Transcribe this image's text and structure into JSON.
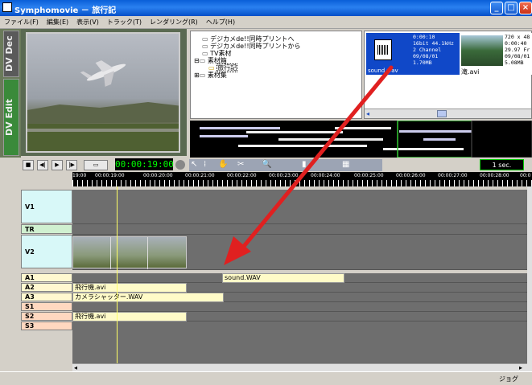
{
  "window": {
    "title": "Symphomovie － 旅行記"
  },
  "menu": [
    "ファイル(F)",
    "編集(E)",
    "表示(V)",
    "トラック(T)",
    "レンダリング(R)",
    "ヘルプ(H)"
  ],
  "side_tabs": [
    "DV Dec",
    "DV Edit"
  ],
  "tree": {
    "items": [
      "デジカメde!!同時プリントへ",
      "デジカメde!!同時プリントから",
      "TV素材",
      "素材箱",
      "旅行記",
      "素材集"
    ]
  },
  "clips": [
    {
      "info": [
        "0:00:10",
        "16bit 44.1kHz",
        "2 Channel",
        "09/08/01",
        "1.70MB"
      ],
      "name": "sound.wav"
    },
    {
      "info": [
        "720 x 48",
        "0:00:40",
        "29.97 Fr",
        "09/08/01",
        "5.08MB"
      ],
      "name": "滝.avi"
    }
  ],
  "controls": {
    "timecode": "00:00:19:00",
    "zoom_label": "1 sec."
  },
  "ruler": {
    "ticks": [
      "19:00",
      "00:00:19:00",
      "00:00:20:00",
      "00:00:21:00",
      "00:00:22:00",
      "00:00:23:00",
      "00:00:24:00",
      "00:00:25:00",
      "00:00:26:00",
      "00:00:27:00",
      "00:00:28:00",
      "00:0"
    ]
  },
  "tracks": {
    "video": [
      "V1",
      "TR",
      "V2"
    ],
    "audio": [
      "A1",
      "A2",
      "A3",
      "S1",
      "S2",
      "S3"
    ]
  },
  "audio_clips": {
    "a1": "sound.WAV",
    "a2": "飛行機.avi",
    "a3": "カメラシャッター.WAV",
    "s2": "飛行機.avi"
  },
  "status": {
    "mode": "ジョグ"
  },
  "colors": {
    "arrow": "#e02020",
    "timeline_bg": "#6e6e6e",
    "timecode": "#00ff00",
    "playhead": "#ffff66"
  }
}
